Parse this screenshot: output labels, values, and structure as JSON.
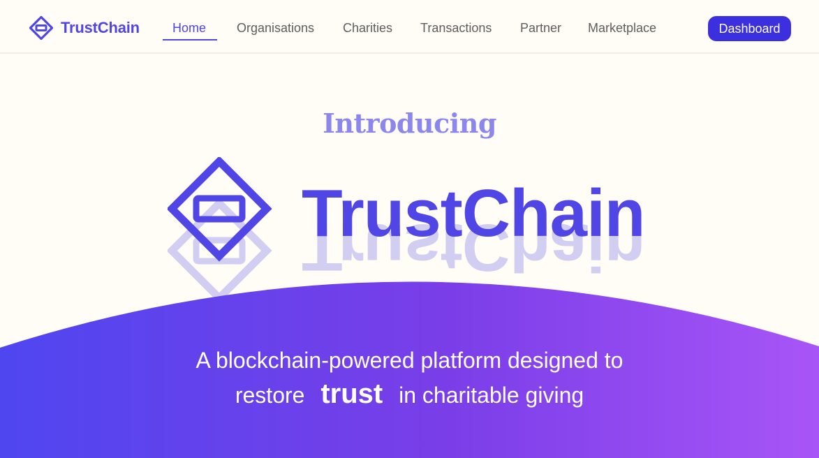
{
  "nav": {
    "brand": "TrustChain",
    "links": [
      "Home",
      "Organisations",
      "Charities",
      "Transactions",
      "Partner",
      "Marketplace"
    ],
    "active_link": "Home",
    "cta_label": "Dashboard"
  },
  "hero": {
    "intro": "Introducing",
    "wordmark": "TrustChain",
    "tagline_line1": "A blockchain-powered platform designed to",
    "tagline_line2_before": "restore",
    "tagline_emphasis": "trust",
    "tagline_line2_after": "in charitable giving"
  },
  "icons": {
    "logo": "diamond-logo-icon"
  },
  "colors": {
    "brand": "#4f46e5",
    "background": "#fffdf6",
    "gradient_start": "#4f46f0",
    "gradient_end": "#a855f7",
    "intro_text": "#8b87ec"
  }
}
